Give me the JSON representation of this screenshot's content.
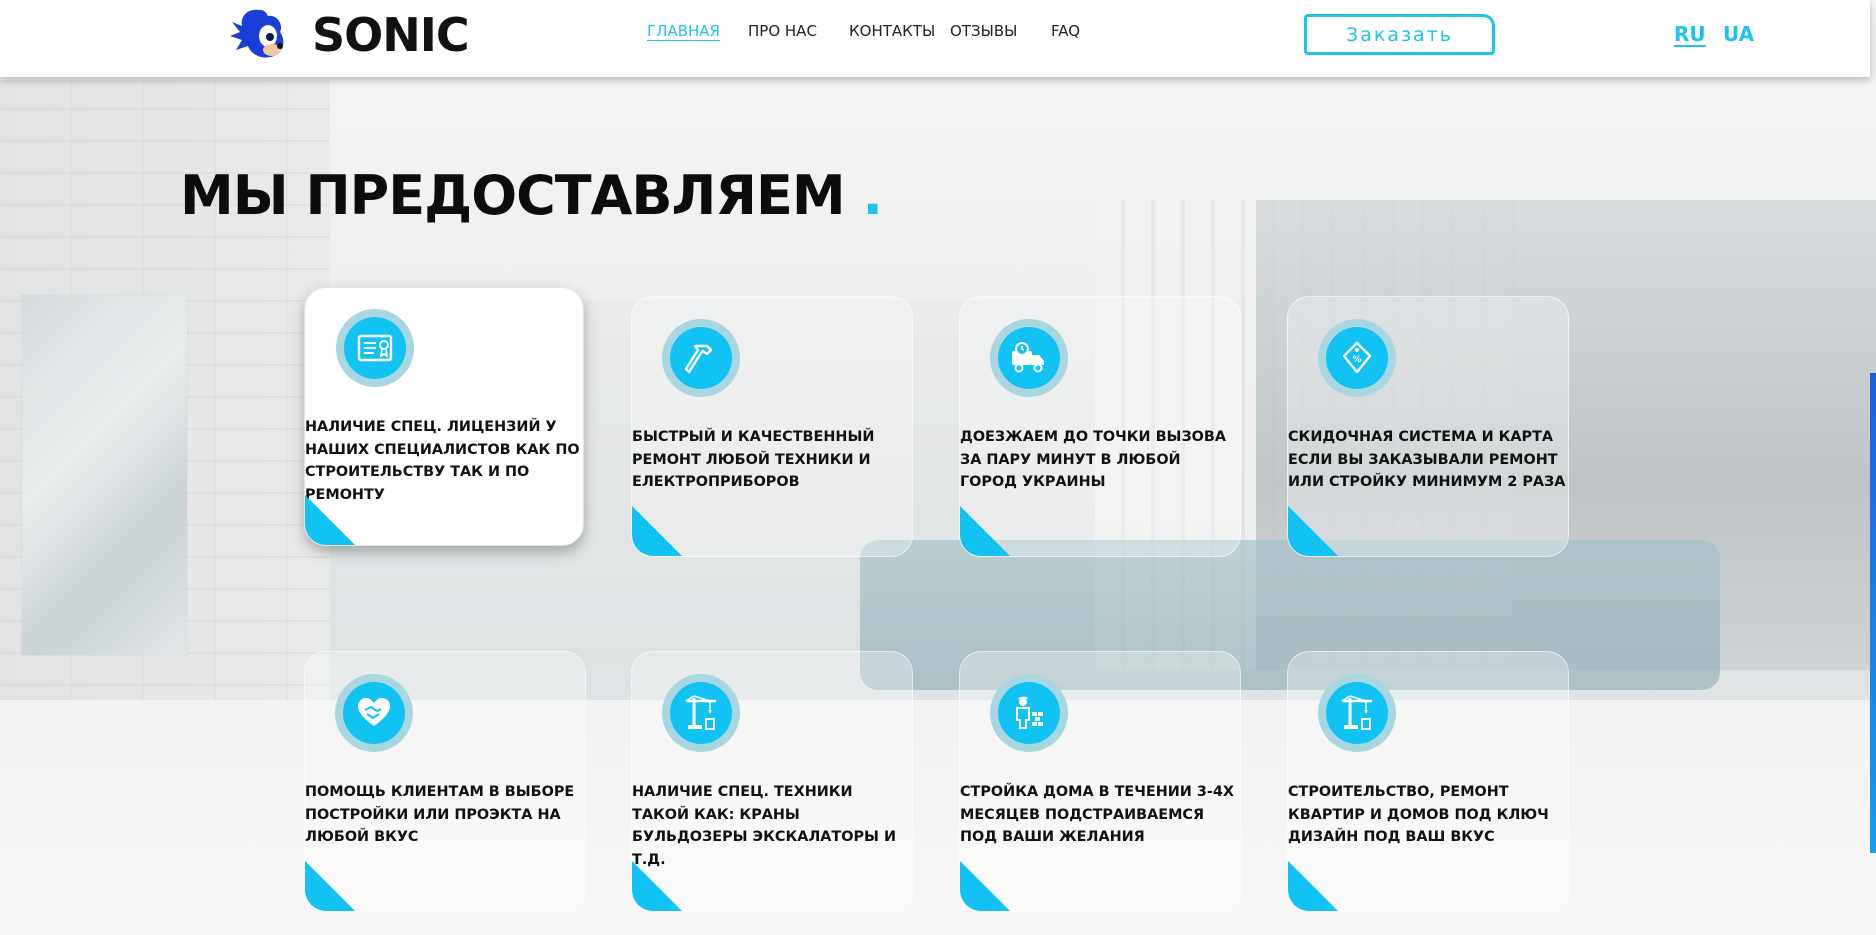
{
  "brand": {
    "name": "SONIC",
    "logo_icon": "hedgehog-head-icon",
    "accent_color": "#1ec3ee"
  },
  "nav": {
    "items": [
      {
        "label": "ГЛАВНАЯ",
        "active": true
      },
      {
        "label": "ПРО НАС",
        "active": false
      },
      {
        "label": "КОНТАКТЫ",
        "active": false
      },
      {
        "label": "ОТЗЫВЫ",
        "active": false
      },
      {
        "label": "FAQ",
        "active": false
      }
    ],
    "order_button": "Заказать",
    "languages": [
      {
        "label": "RU",
        "active": true
      },
      {
        "label": "UA",
        "active": false
      }
    ]
  },
  "section": {
    "title": "МЫ ПРЕДОСТАВЛЯЕМ",
    "title_dot": ".",
    "cards": [
      {
        "icon": "license-certificate-icon",
        "text": "НАЛИЧИЕ СПЕЦ. ЛИЦЕНЗИЙ У НАШИХ СПЕЦИАЛИСТОВ КАК ПО СТРОИТЕЛЬСТВУ ТАК И ПО РЕМОНТУ",
        "featured": true
      },
      {
        "icon": "hammer-icon",
        "text": "БЫСТРЫЙ И КАЧЕСТВЕННЫЙ РЕМОНТ ЛЮБОЙ ТЕХНИКИ И ЕЛЕКТРОПРИБОРОВ",
        "featured": false
      },
      {
        "icon": "delivery-truck-icon",
        "text": "ДОЕЗЖАЕМ ДО ТОЧКИ ВЫЗОВА ЗА ПАРУ МИНУТ В ЛЮБОЙ ГОРОД УКРАИНЫ",
        "featured": false
      },
      {
        "icon": "discount-tag-icon",
        "text": "СКИДОЧНАЯ СИСТЕМА И КАРТА ЕСЛИ ВЫ ЗАКАЗЫВАЛИ РЕМОНТ ИЛИ СТРОЙКУ МИНИМУМ 2 РАЗА",
        "featured": false
      },
      {
        "icon": "heart-handshake-icon",
        "text": "ПОМОЩЬ КЛИЕНТАМ В ВЫБОРЕ ПОСТРОЙКИ ИЛИ ПРОЭКТА НА ЛЮБОЙ ВКУС",
        "featured": false
      },
      {
        "icon": "crane-icon",
        "text": "НАЛИЧИЕ СПЕЦ. ТЕХНИКИ ТАКОЙ КАК: КРАНЫ БУЛЬДОЗЕРЫ ЭКСКАЛАТОРЫ И Т.Д.",
        "featured": false
      },
      {
        "icon": "builder-bricks-icon",
        "text": "СТРОЙКА ДОМА В ТЕЧЕНИИ 3-4Х МЕСЯЦЕВ ПОДСТРАИВАЕМСЯ ПОД ВАШИ ЖЕЛАНИЯ",
        "featured": false
      },
      {
        "icon": "crane-icon",
        "text": "СТРОИТЕЛЬСТВО, РЕМОНТ КВАРТИР И ДОМОВ ПОД КЛЮЧ ДИЗАЙН ПОД ВАШ ВКУС",
        "featured": false
      }
    ]
  }
}
